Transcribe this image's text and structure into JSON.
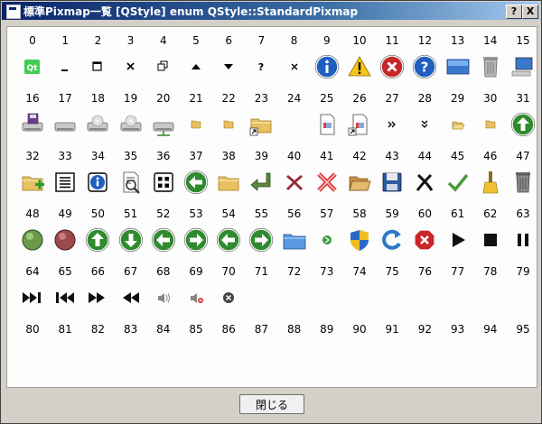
{
  "window": {
    "title": "標準Pixmap一覧 [QStyle] enum QStyle::StandardPixmap"
  },
  "titlebar": {
    "help": "?",
    "close": "X"
  },
  "grid": {
    "columns": 16,
    "cells": [
      {
        "n": "0",
        "icon": "qt-logo-icon"
      },
      {
        "n": "1",
        "icon": "minimize-icon"
      },
      {
        "n": "2",
        "icon": "maximize-icon"
      },
      {
        "n": "3",
        "icon": "close-x-icon"
      },
      {
        "n": "4",
        "icon": "restore-icon"
      },
      {
        "n": "5",
        "icon": "shade-icon"
      },
      {
        "n": "6",
        "icon": "unshade-icon"
      },
      {
        "n": "7",
        "icon": "context-help-icon"
      },
      {
        "n": "8",
        "icon": "dock-close-icon"
      },
      {
        "n": "9",
        "icon": "information-icon"
      },
      {
        "n": "10",
        "icon": "warning-icon"
      },
      {
        "n": "11",
        "icon": "critical-icon"
      },
      {
        "n": "12",
        "icon": "question-icon"
      },
      {
        "n": "13",
        "icon": "desktop-icon"
      },
      {
        "n": "14",
        "icon": "trash-icon"
      },
      {
        "n": "15",
        "icon": "computer-icon"
      },
      {
        "n": "16",
        "icon": "floppy-drive-icon"
      },
      {
        "n": "17",
        "icon": "hard-drive-icon"
      },
      {
        "n": "18",
        "icon": "cdrom-drive-icon"
      },
      {
        "n": "19",
        "icon": "dvd-drive-icon"
      },
      {
        "n": "20",
        "icon": "network-drive-icon"
      },
      {
        "n": "21",
        "icon": "small-folder-icon"
      },
      {
        "n": "22",
        "icon": "small-folder-icon"
      },
      {
        "n": "23",
        "icon": "folder-link-icon"
      },
      {
        "n": "24",
        "icon": "none"
      },
      {
        "n": "25",
        "icon": "file-icon"
      },
      {
        "n": "26",
        "icon": "file-link-icon"
      },
      {
        "n": "27",
        "icon": "toolbar-ext-h-icon"
      },
      {
        "n": "28",
        "icon": "toolbar-ext-v-icon"
      },
      {
        "n": "29",
        "icon": "dir-open-small-icon"
      },
      {
        "n": "30",
        "icon": "dir-closed-small-icon"
      },
      {
        "n": "31",
        "icon": "arrow-up-green-icon"
      },
      {
        "n": "32",
        "icon": "new-folder-icon"
      },
      {
        "n": "33",
        "icon": "list-view-icon"
      },
      {
        "n": "34",
        "icon": "detail-view-icon"
      },
      {
        "n": "35",
        "icon": "info-view-icon"
      },
      {
        "n": "36",
        "icon": "contents-view-icon"
      },
      {
        "n": "37",
        "icon": "back-green-icon"
      },
      {
        "n": "38",
        "icon": "folder-icon"
      },
      {
        "n": "39",
        "icon": "return-arrow-icon"
      },
      {
        "n": "40",
        "icon": "dialog-cancel-icon"
      },
      {
        "n": "41",
        "icon": "dialog-discard-icon"
      },
      {
        "n": "42",
        "icon": "dialog-open-icon"
      },
      {
        "n": "43",
        "icon": "dialog-save-icon"
      },
      {
        "n": "44",
        "icon": "dialog-close-icon"
      },
      {
        "n": "45",
        "icon": "dialog-apply-icon"
      },
      {
        "n": "46",
        "icon": "dialog-reset-icon"
      },
      {
        "n": "47",
        "icon": "dialog-discard-trash-icon"
      },
      {
        "n": "48",
        "icon": "dialog-yes-icon"
      },
      {
        "n": "49",
        "icon": "dialog-no-icon"
      },
      {
        "n": "50",
        "icon": "arrow-up-icon"
      },
      {
        "n": "51",
        "icon": "arrow-down-icon"
      },
      {
        "n": "52",
        "icon": "arrow-left-icon"
      },
      {
        "n": "53",
        "icon": "arrow-right-icon"
      },
      {
        "n": "54",
        "icon": "arrow-back-icon"
      },
      {
        "n": "55",
        "icon": "arrow-forward-icon"
      },
      {
        "n": "56",
        "icon": "directory-home-icon"
      },
      {
        "n": "57",
        "icon": "command-link-icon"
      },
      {
        "n": "58",
        "icon": "vista-shield-icon"
      },
      {
        "n": "59",
        "icon": "browser-reload-icon"
      },
      {
        "n": "60",
        "icon": "browser-stop-icon"
      },
      {
        "n": "61",
        "icon": "media-play-icon"
      },
      {
        "n": "62",
        "icon": "media-stop-icon"
      },
      {
        "n": "63",
        "icon": "media-pause-icon"
      },
      {
        "n": "64",
        "icon": "media-skip-forward-icon"
      },
      {
        "n": "65",
        "icon": "media-skip-backward-icon"
      },
      {
        "n": "66",
        "icon": "media-seek-forward-icon"
      },
      {
        "n": "67",
        "icon": "media-seek-backward-icon"
      },
      {
        "n": "68",
        "icon": "media-volume-icon"
      },
      {
        "n": "69",
        "icon": "media-volume-muted-icon"
      },
      {
        "n": "70",
        "icon": "line-edit-clear-icon"
      },
      {
        "n": "71",
        "icon": "none"
      },
      {
        "n": "72",
        "icon": "none"
      },
      {
        "n": "73",
        "icon": "none"
      },
      {
        "n": "74",
        "icon": "none"
      },
      {
        "n": "75",
        "icon": "none"
      },
      {
        "n": "76",
        "icon": "none"
      },
      {
        "n": "77",
        "icon": "none"
      },
      {
        "n": "78",
        "icon": "none"
      },
      {
        "n": "79",
        "icon": "none"
      },
      {
        "n": "80",
        "icon": "none"
      },
      {
        "n": "81",
        "icon": "none"
      },
      {
        "n": "82",
        "icon": "none"
      },
      {
        "n": "83",
        "icon": "none"
      },
      {
        "n": "84",
        "icon": "none"
      },
      {
        "n": "85",
        "icon": "none"
      },
      {
        "n": "86",
        "icon": "none"
      },
      {
        "n": "87",
        "icon": "none"
      },
      {
        "n": "88",
        "icon": "none"
      },
      {
        "n": "89",
        "icon": "none"
      },
      {
        "n": "90",
        "icon": "none"
      },
      {
        "n": "91",
        "icon": "none"
      },
      {
        "n": "92",
        "icon": "none"
      },
      {
        "n": "93",
        "icon": "none"
      },
      {
        "n": "94",
        "icon": "none"
      },
      {
        "n": "95",
        "icon": "none"
      }
    ]
  },
  "footer": {
    "close_label": "閉じる"
  },
  "colors": {
    "green": "#2e8b2e",
    "blue": "#1e5fbf",
    "red": "#c8262a",
    "folder": "#e8c060",
    "titlebar": "#0a246a"
  }
}
